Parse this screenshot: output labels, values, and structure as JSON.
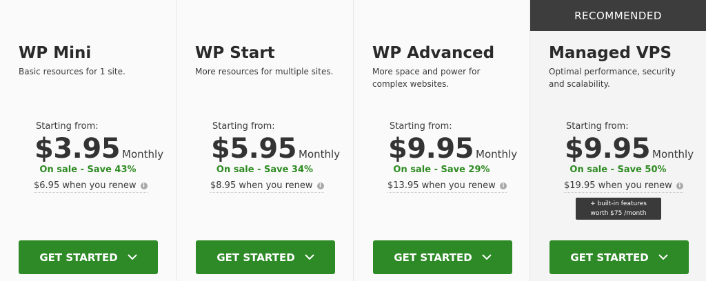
{
  "recommended_label": "RECOMMENDED",
  "colors": {
    "accent_green": "#2d8a26",
    "sale_green": "#2e8b22",
    "banner_dark": "#3d3d3d"
  },
  "plans": [
    {
      "name": "WP Mini",
      "description": "Basic resources for 1 site.",
      "starting_label": "Starting from:",
      "price": "$3.95",
      "period": "Monthly",
      "sale_text": "On sale - Save 43%",
      "renew_text": "$6.95 when you renew",
      "cta_label": "GET STARTED"
    },
    {
      "name": "WP Start",
      "description": "More resources for multiple sites.",
      "starting_label": "Starting from:",
      "price": "$5.95",
      "period": "Monthly",
      "sale_text": "On sale - Save 34%",
      "renew_text": "$8.95 when you renew",
      "cta_label": "GET STARTED"
    },
    {
      "name": "WP Advanced",
      "description": "More space and power for complex websites.",
      "starting_label": "Starting from:",
      "price": "$9.95",
      "period": "Monthly",
      "sale_text": "On sale - Save 29%",
      "renew_text": "$13.95 when you renew",
      "cta_label": "GET STARTED"
    },
    {
      "name": "Managed VPS",
      "description": "Optimal performance, security and scalability.",
      "starting_label": "Starting from:",
      "price": "$9.95",
      "period": "Monthly",
      "sale_text": "On sale - Save 50%",
      "renew_text": "$19.95 when you renew",
      "tooltip_line1": "+ built-in features",
      "tooltip_line2": "worth $75 /month",
      "cta_label": "GET STARTED"
    }
  ]
}
